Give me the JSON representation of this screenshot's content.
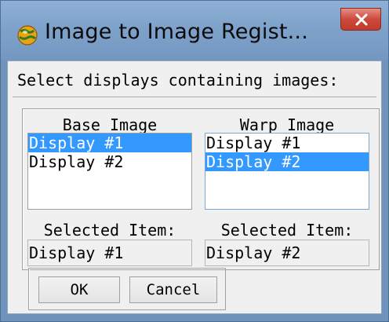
{
  "window": {
    "title": "Image to Image Regist..."
  },
  "prompt": "Select displays containing images:",
  "base": {
    "header": "Base Image",
    "items": [
      "Display #1",
      "Display #2"
    ],
    "selected_label": "Selected Item:",
    "selected_value": "Display #1"
  },
  "warp": {
    "header": "Warp Image",
    "items": [
      "Display #1",
      "Display #2"
    ],
    "selected_label": "Selected Item:",
    "selected_value": "Display #2"
  },
  "buttons": {
    "ok": "OK",
    "cancel": "Cancel"
  },
  "icons": {
    "app": "globe-icon",
    "close": "close-icon"
  },
  "colors": {
    "selection": "#3399ff",
    "close_button": "#c94436",
    "titlebar": "#7ea2ca"
  }
}
